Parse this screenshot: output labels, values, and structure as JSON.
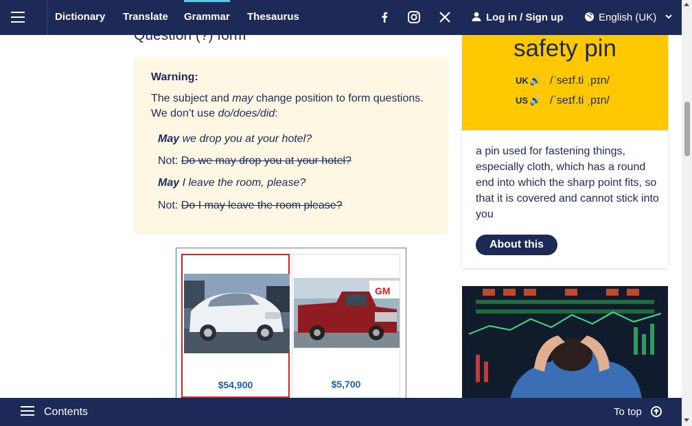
{
  "nav": {
    "links": [
      "Dictionary",
      "Translate",
      "Grammar",
      "Thesaurus"
    ],
    "active": "Grammar",
    "social_icons": [
      "facebook-icon",
      "instagram-icon",
      "x-icon"
    ],
    "login_label": "Log in / Sign up",
    "language_label": "English (UK)"
  },
  "main": {
    "section_heading": "Question (?) form",
    "warning": {
      "title": "Warning:",
      "text_part1": "The subject and ",
      "text_may": "may",
      "text_part2": " change position to form questions. We don’t use ",
      "text_dodoes": "do/does/did",
      "text_part3": ":",
      "examples": [
        {
          "bold": "May",
          "rest": " we drop you at your hotel?"
        },
        {
          "not": "Not: ",
          "struck": "Do we may drop you at your hotel?"
        },
        {
          "bold": "May",
          "rest": " I leave the room, please?"
        },
        {
          "not": "Not: ",
          "struck": "Do I may leave the room please?"
        }
      ]
    }
  },
  "ad": {
    "items": [
      {
        "price": "$54,900",
        "image": "white-luxury-car-image"
      },
      {
        "price": "$5,700",
        "image": "red-pickup-truck-image"
      }
    ]
  },
  "word_card": {
    "headword": "safety pin",
    "pron_uk_label": "UK",
    "pron_uk": "/ˈseɪf.ti ˌpɪn/",
    "pron_us_label": "US",
    "pron_us": "/ˈseɪf.ti ˌpɪn/",
    "definition": "a pin used for fastening things, especially cloth, which has a round end into which the sharp point fits, so that it is covered and cannot stick into you",
    "about_button": "About this"
  },
  "bottom": {
    "contents_label": "Contents",
    "totop_label": "To top"
  },
  "colors": {
    "navy": "#1d2a57",
    "accent_yellow": "#fdc800",
    "warning_bg": "#fef7e3",
    "price_blue": "#1f5fa8"
  }
}
